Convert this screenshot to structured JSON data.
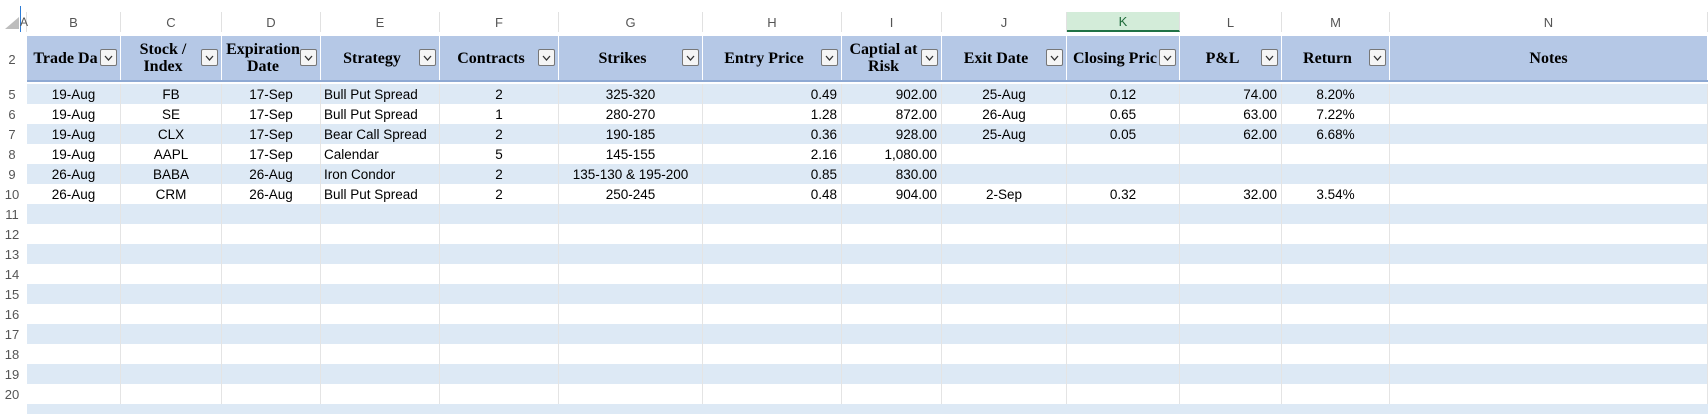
{
  "column_letters": [
    "A",
    "B",
    "C",
    "D",
    "E",
    "F",
    "G",
    "H",
    "I",
    "J",
    "K",
    "L",
    "M",
    "N"
  ],
  "selected_column": "K",
  "row_numbers": [
    "2",
    "5",
    "6",
    "7",
    "8",
    "9",
    "10",
    "11",
    "12",
    "13",
    "14",
    "15",
    "16",
    "17",
    "18",
    "19",
    "20"
  ],
  "headers": [
    "Trade Da",
    "Stock /\nIndex",
    "Expiration\nDate",
    "Strategy",
    "Contracts",
    "Strikes",
    "Entry Price",
    "Captial at\nRisk",
    "Exit Date",
    "Closing Pric",
    "P&L",
    "Return",
    "Notes"
  ],
  "rows": [
    [
      "19-Aug",
      "FB",
      "17-Sep",
      "Bull Put Spread",
      "2",
      "325-320",
      "0.49",
      "902.00",
      "25-Aug",
      "0.12",
      "74.00",
      "8.20%",
      ""
    ],
    [
      "19-Aug",
      "SE",
      "17-Sep",
      "Bull Put Spread",
      "1",
      "280-270",
      "1.28",
      "872.00",
      "26-Aug",
      "0.65",
      "63.00",
      "7.22%",
      ""
    ],
    [
      "19-Aug",
      "CLX",
      "17-Sep",
      "Bear Call Spread",
      "2",
      "190-185",
      "0.36",
      "928.00",
      "25-Aug",
      "0.05",
      "62.00",
      "6.68%",
      ""
    ],
    [
      "19-Aug",
      "AAPL",
      "17-Sep",
      "Calendar",
      "5",
      "145-155",
      "2.16",
      "1,080.00",
      "",
      "",
      "",
      "",
      ""
    ],
    [
      "26-Aug",
      "BABA",
      "26-Aug",
      "Iron Condor",
      "2",
      "135-130 & 195-200",
      "0.85",
      "830.00",
      "",
      "",
      "",
      "",
      ""
    ],
    [
      "26-Aug",
      "CRM",
      "26-Aug",
      "Bull Put Spread",
      "2",
      "250-245",
      "0.48",
      "904.00",
      "2-Sep",
      "0.32",
      "32.00",
      "3.54%",
      ""
    ]
  ],
  "colors": {
    "header_fill": "#b5c8e6",
    "band_fill": "#dde9f5",
    "selected_col": "#d3ecd9"
  },
  "icons": {
    "filter": "dropdown-filter-icon",
    "corner": "select-all-triangle-icon"
  }
}
